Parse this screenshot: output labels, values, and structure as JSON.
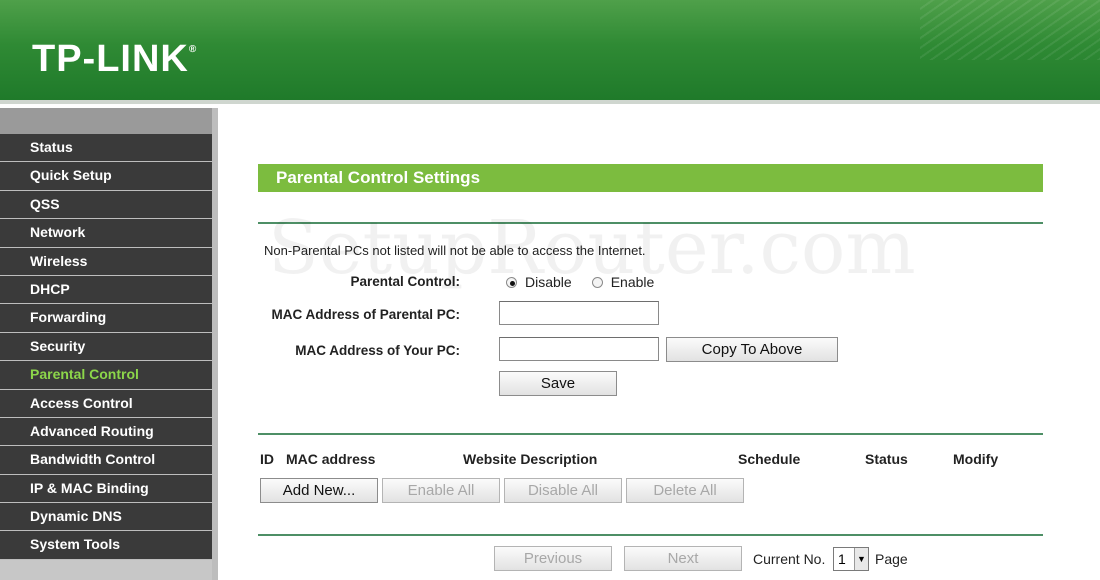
{
  "header": {
    "logo_text": "TP-LINK",
    "logo_mark": "®"
  },
  "sidebar": {
    "items": [
      {
        "label": "Status",
        "active": false
      },
      {
        "label": "Quick Setup",
        "active": false
      },
      {
        "label": "QSS",
        "active": false
      },
      {
        "label": "Network",
        "active": false
      },
      {
        "label": "Wireless",
        "active": false
      },
      {
        "label": "DHCP",
        "active": false
      },
      {
        "label": "Forwarding",
        "active": false
      },
      {
        "label": "Security",
        "active": false
      },
      {
        "label": "Parental Control",
        "active": true
      },
      {
        "label": "Access Control",
        "active": false
      },
      {
        "label": "Advanced Routing",
        "active": false
      },
      {
        "label": "Bandwidth Control",
        "active": false
      },
      {
        "label": "IP & MAC Binding",
        "active": false
      },
      {
        "label": "Dynamic DNS",
        "active": false
      },
      {
        "label": "System Tools",
        "active": false
      }
    ]
  },
  "main": {
    "title": "Parental Control Settings",
    "note": "Non-Parental PCs not listed will not be able to access the Internet.",
    "parental_control_label": "Parental Control:",
    "radio_disable": "Disable",
    "radio_enable": "Enable",
    "selected_option": "Disable",
    "mac_parental_label": "MAC Address of Parental PC:",
    "mac_parental_value": "",
    "mac_your_label": "MAC Address of Your PC:",
    "mac_your_value": "",
    "copy_button": "Copy To Above",
    "save_button": "Save"
  },
  "table": {
    "headers": [
      "ID",
      "MAC address",
      "Website Description",
      "Schedule",
      "Status",
      "Modify"
    ],
    "rows": []
  },
  "actions": {
    "add_new": "Add New...",
    "enable_all": "Enable All",
    "disable_all": "Disable All",
    "delete_all": "Delete All"
  },
  "pager": {
    "previous": "Previous",
    "next": "Next",
    "current_label": "Current No.",
    "current_value": "1",
    "page_label": "Page"
  },
  "watermark": "SetupRouter.com",
  "colors": {
    "header_green": "#2f8a34",
    "title_bar": "#7cbc3f",
    "active_nav": "#8cd64a",
    "nav_bg": "#3a3a3a"
  }
}
